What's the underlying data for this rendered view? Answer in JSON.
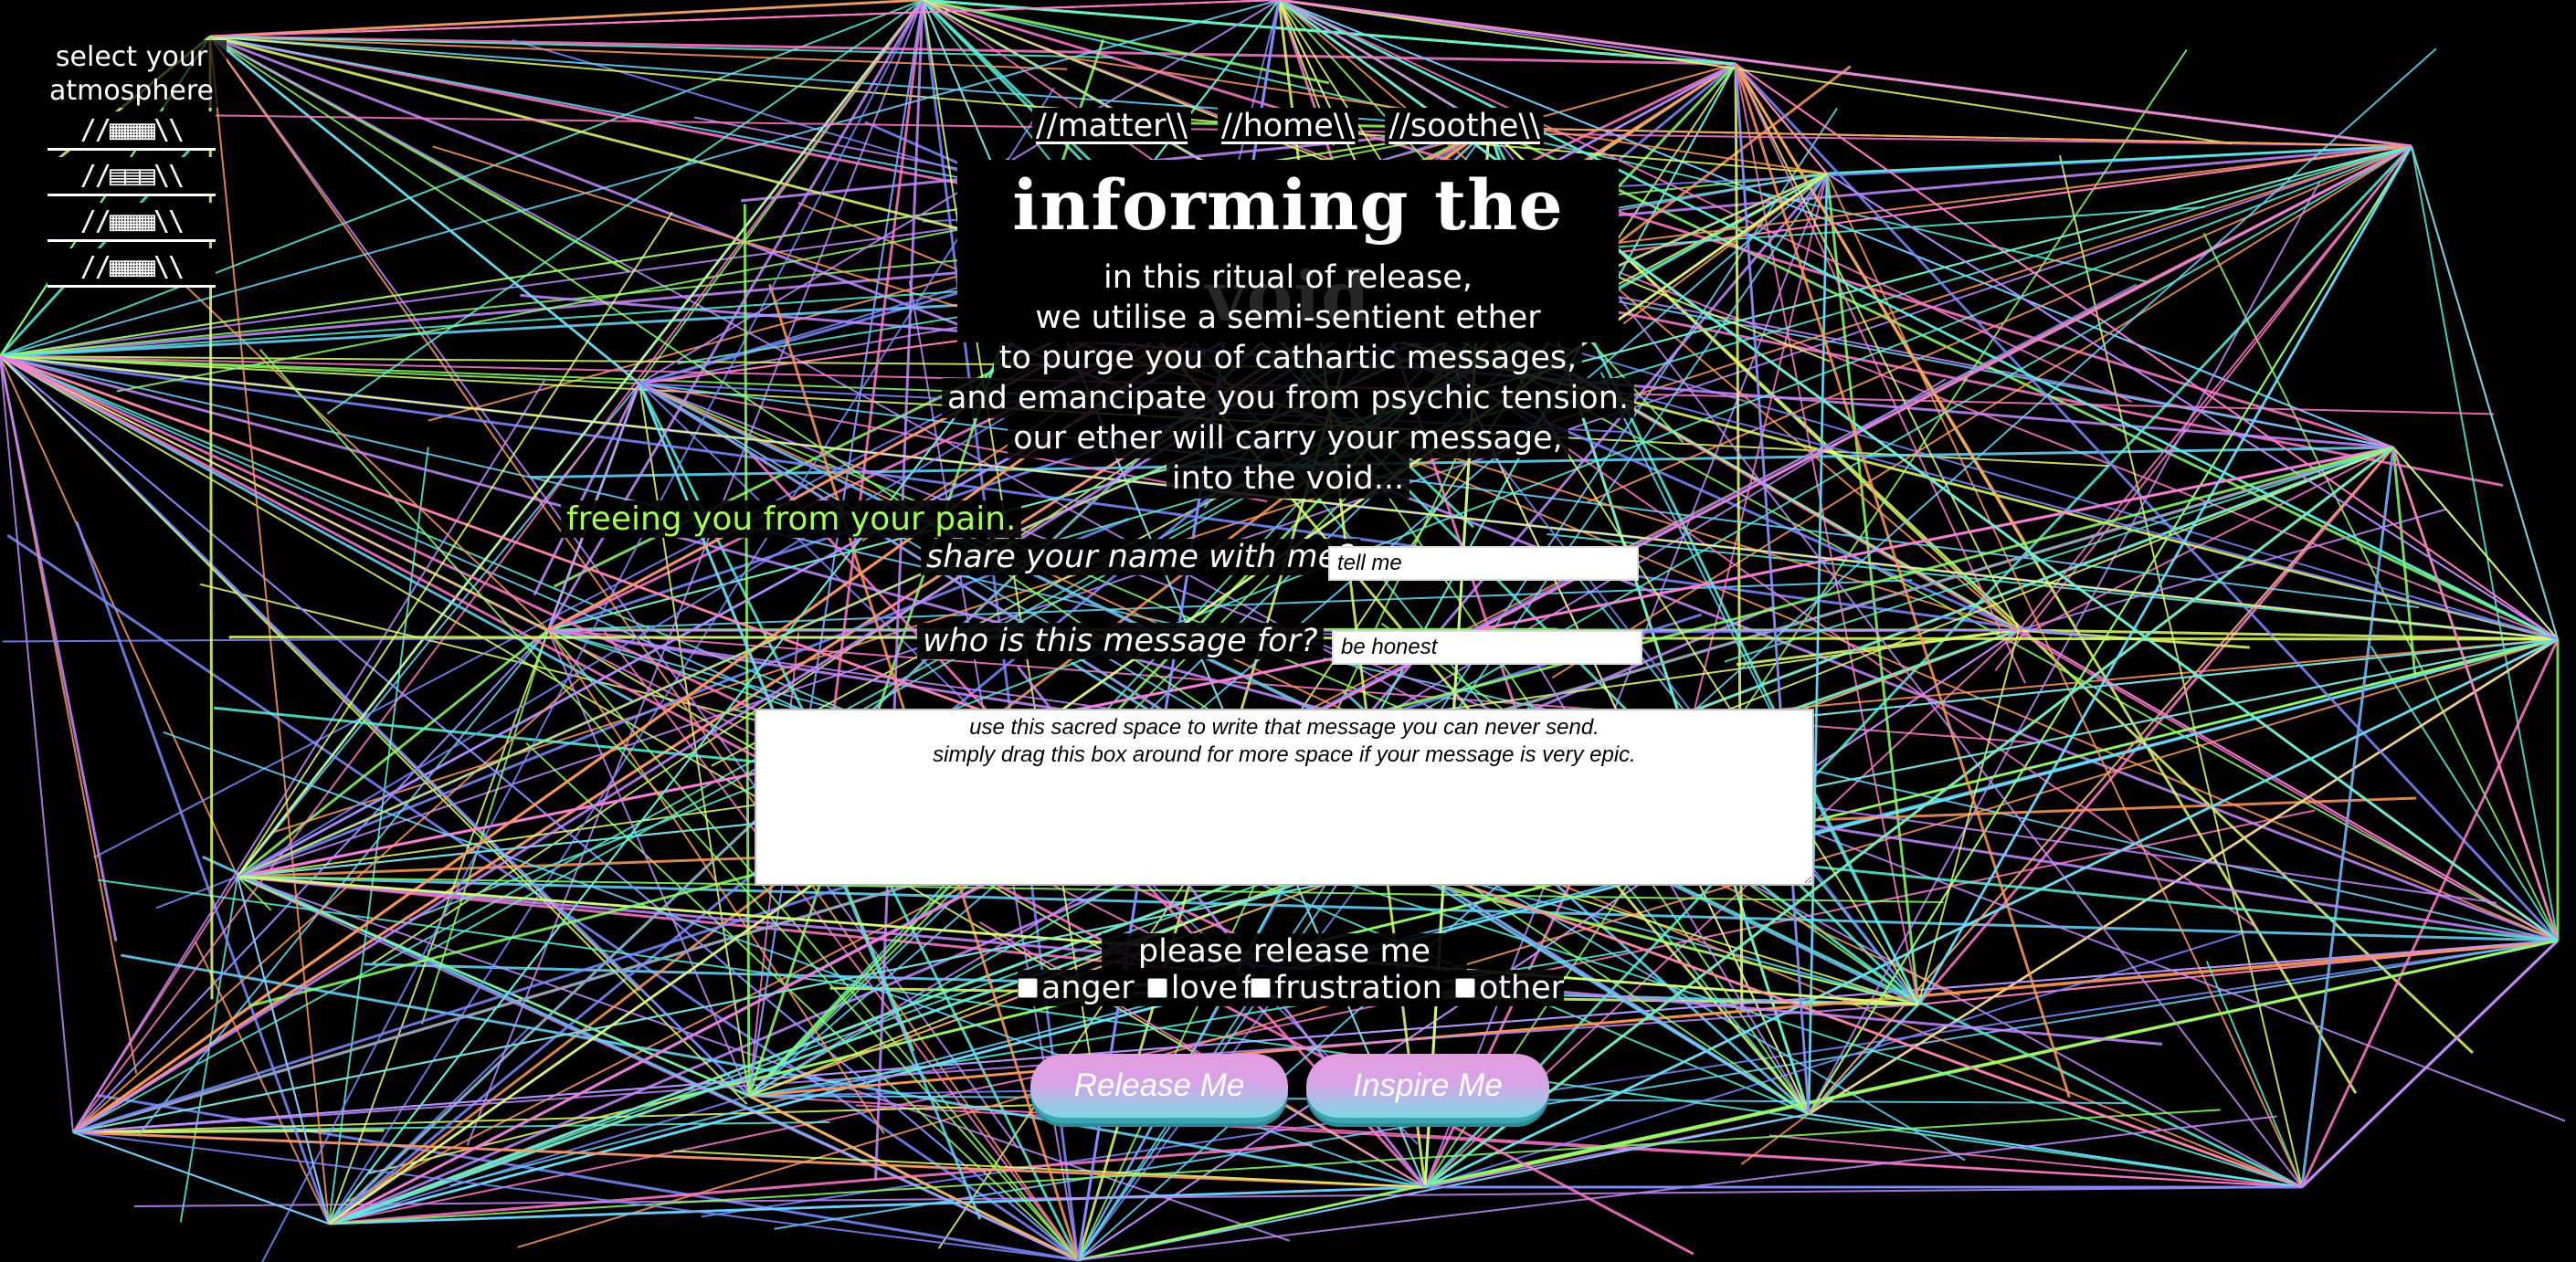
{
  "atmosphere": {
    "label": "select your atmosphere",
    "options": [
      "//▦▦▦\\\\",
      "//▤▤▤\\\\",
      "//▦▦▦\\\\",
      "//▦▦▦\\\\"
    ]
  },
  "nav": [
    "//matter\\\\",
    "//home\\\\",
    "//soothe\\\\"
  ],
  "title": "informing the void",
  "intro": [
    "in this ritual of release,",
    "we utilise a semi-sentient ether",
    "to purge you of cathartic messages,",
    "and emancipate you from psychic tension.",
    "our ether will carry your message,",
    "into the void..."
  ],
  "tagline": "freeing you from your pain.",
  "form": {
    "name_label": "share your name with me?",
    "name_placeholder": "tell me",
    "recipient_label": "who is this message for?",
    "recipient_placeholder": "be honest",
    "message_placeholder": "use this sacred space to write that message you can never send.\nsimply drag this box around for more space if your message is very epic.",
    "release_label": "please release me from:",
    "release_options": [
      "anger",
      "love",
      "frustration",
      "other"
    ],
    "release_button": "Release Me",
    "inspire_button": "Inspire Me"
  },
  "colors": {
    "background": "#000000",
    "tagline": "#a6ff55",
    "button_top": "#e39cde",
    "button_bottom": "#7fd8e3"
  }
}
